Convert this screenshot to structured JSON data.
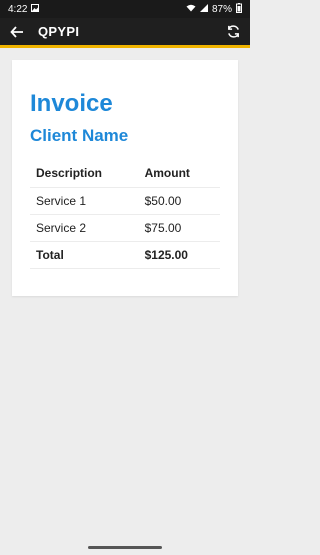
{
  "status": {
    "time": "4:22",
    "battery": "87%"
  },
  "app_bar": {
    "title": "QPYPI"
  },
  "invoice": {
    "title": "Invoice",
    "client": "Client Name",
    "columns": [
      "Description",
      "Amount"
    ],
    "rows": [
      {
        "description": "Service 1",
        "amount": "$50.00"
      },
      {
        "description": "Service 2",
        "amount": "$75.00"
      }
    ],
    "total": {
      "label": "Total",
      "amount": "$125.00"
    }
  }
}
